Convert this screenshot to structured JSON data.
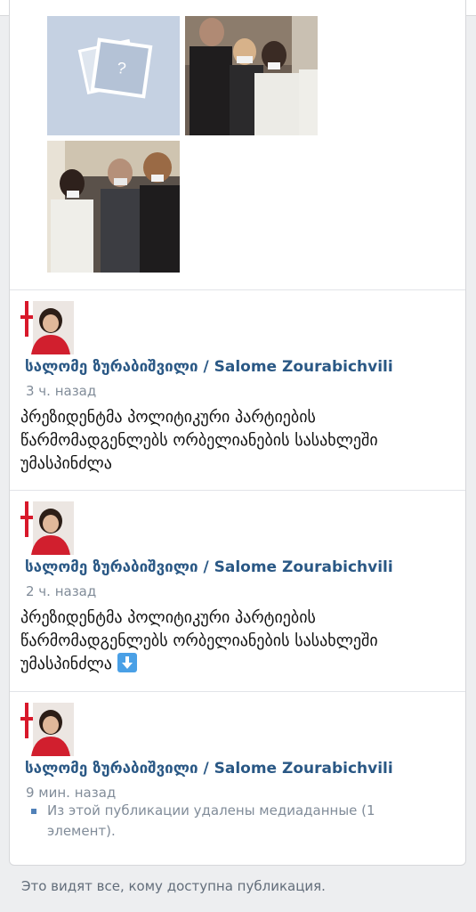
{
  "post_author": "სალომე ზურაბიშვილი / Salome Zourabichvili",
  "posts": [
    {
      "time": "3 ч. назад",
      "text": "პრეზიდენტმა პოლიტიკური პარტიების წარმომადგენლებს ორბელიანების სასახლეში უმასპინძლა"
    },
    {
      "time": "2 ч. назад",
      "text": "პრეზიდენტმა პოლიტიკური პარტიების წარმომადგენლებს ორბელიანების სასახლეში უმასპინძლა",
      "emoji": "down-arrow-emoji"
    },
    {
      "time": "9 мин. назад",
      "notice": "Из этой публикации удалены медиаданные (1 элемент)."
    }
  ],
  "footer": {
    "visibility_text": "Это видят все, кому доступна публикация."
  },
  "colors": {
    "author_link": "#2a5885",
    "secondary_text": "#818c99",
    "background": "#edeef0",
    "placeholder": "#c5d1e2"
  },
  "icons": {
    "placeholder": "missing-photo-icon",
    "bullet": "bullet-square-icon"
  }
}
